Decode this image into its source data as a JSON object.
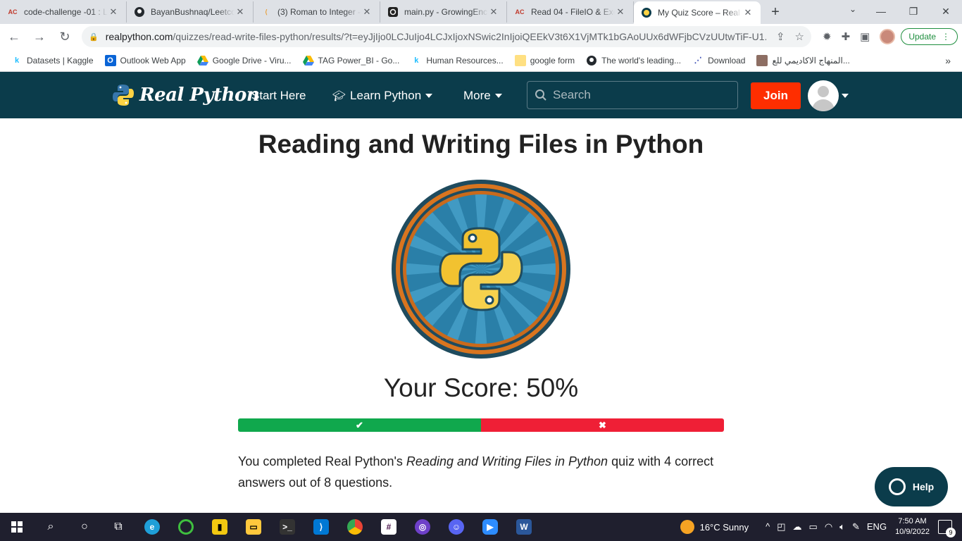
{
  "browser": {
    "tabs": [
      {
        "title": "code-challenge -01 : L",
        "favicon": "asac-icon",
        "active": false
      },
      {
        "title": "BayanBushnaq/Leetco",
        "favicon": "github-icon",
        "active": false
      },
      {
        "title": "(3) Roman to Integer -",
        "favicon": "leetcode-icon",
        "active": false
      },
      {
        "title": "main.py - GrowingEnc",
        "favicon": "replit-icon",
        "active": false
      },
      {
        "title": "Read 04 - FileIO & Exc",
        "favicon": "asac-icon",
        "active": false
      },
      {
        "title": "My Quiz Score – Real",
        "favicon": "realpython-icon",
        "active": true
      }
    ],
    "url_host": "realpython.com",
    "url_path": "/quizzes/read-write-files-python/results/?t=eyJjIjo0LCJuIjo4LCJxIjoxNSwic2InIjoiQEEkV3t6X1VjMTk1bGAoUUx6dWFjbCVzUUtwTiF-U1...",
    "update_label": "Update",
    "bookmarks": [
      {
        "label": "Datasets | Kaggle",
        "icon": "kaggle-icon"
      },
      {
        "label": "Outlook Web App",
        "icon": "outlook-icon"
      },
      {
        "label": "Google Drive - Viru...",
        "icon": "drive-icon"
      },
      {
        "label": "TAG Power_BI - Go...",
        "icon": "drive-icon"
      },
      {
        "label": "Human Resources...",
        "icon": "kaggle-icon"
      },
      {
        "label": "google form",
        "icon": "folder-icon"
      },
      {
        "label": "The world's leading...",
        "icon": "github-icon"
      },
      {
        "label": "Download",
        "icon": "download-icon"
      },
      {
        "label": "المنهاج الاكاديمي للع...",
        "icon": "books-icon"
      }
    ]
  },
  "site": {
    "logo_text": "Real Python",
    "nav": {
      "start_here": "Start Here",
      "learn_python": "Learn Python",
      "more": "More"
    },
    "search_placeholder": "Search",
    "join_label": "Join"
  },
  "quiz": {
    "title": "Reading and Writing Files in Python",
    "score_text": "Your Score: 50%",
    "score_fraction": 0.5,
    "summary_prefix": "You completed Real Python's ",
    "summary_quiz_name": "Reading and Writing Files in Python",
    "summary_suffix": " quiz with 4 correct answers out of 8 questions."
  },
  "help_label": "Help",
  "taskbar": {
    "weather": "16°C  Sunny",
    "language": "ENG",
    "time": "7:50 AM",
    "date": "10/9/2022",
    "notifications": "9"
  },
  "colors": {
    "header_bg": "#0b3c4b",
    "join_bg": "#fe2e00",
    "correct": "#10a84d",
    "wrong": "#ef1f36"
  }
}
